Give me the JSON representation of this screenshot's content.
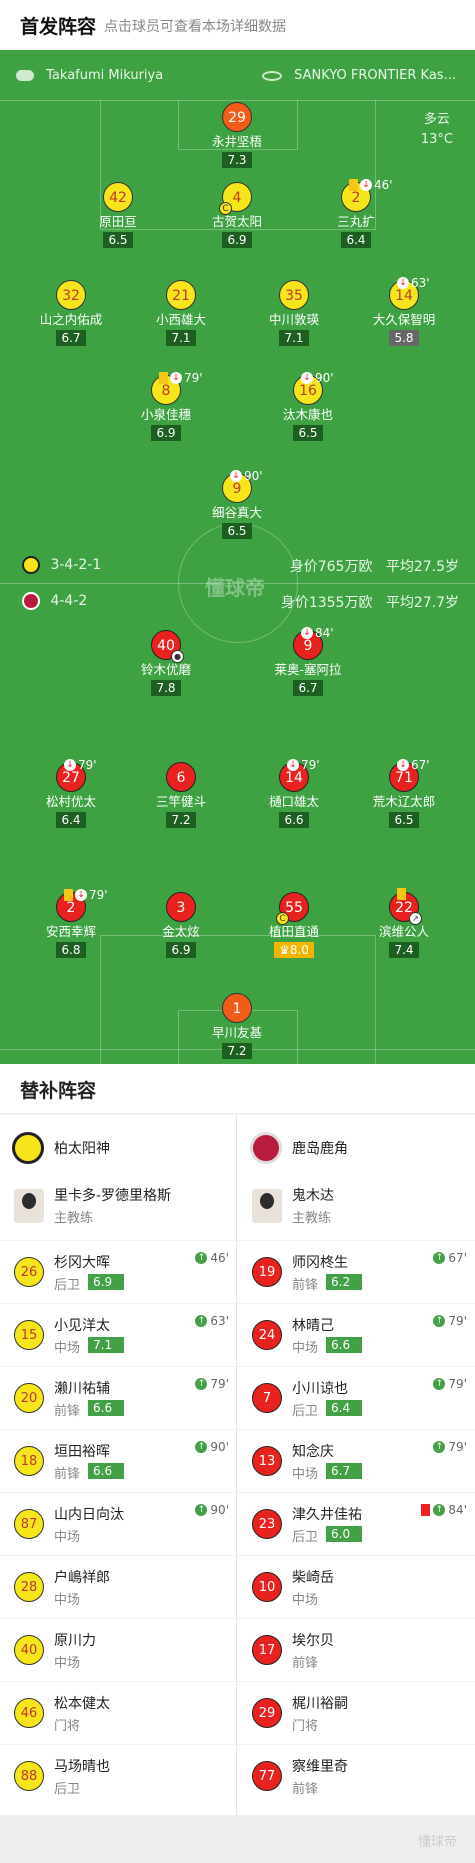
{
  "header": {
    "title": "首发阵容",
    "subtitle": "点击球员可查看本场详细数据"
  },
  "match": {
    "referee": "Takafumi Mikuriya",
    "venue": "SANKYO FRONTIER Kas...",
    "weather": "多云",
    "temperature": "13°C",
    "watermark": "懂球帝"
  },
  "home": {
    "formation": "3-4-2-1",
    "value": "身价765万欧",
    "age": "平均27.5岁"
  },
  "away": {
    "formation": "4-4-2",
    "value": "身价1355万欧",
    "age": "平均27.7岁"
  },
  "home_players": [
    {
      "num": "29",
      "name": "永井坚梧",
      "rating": "7.3",
      "style": "o"
    },
    {
      "num": "42",
      "name": "原田亘",
      "rating": "6.5",
      "style": "y"
    },
    {
      "num": "4",
      "name": "古贺太阳",
      "rating": "6.9",
      "style": "y",
      "cap": "C"
    },
    {
      "num": "2",
      "name": "三丸扩",
      "rating": "6.4",
      "style": "y",
      "minute": "46'"
    },
    {
      "num": "32",
      "name": "山之内佑成",
      "rating": "6.7",
      "style": "y"
    },
    {
      "num": "21",
      "name": "小西雄大",
      "rating": "7.1",
      "style": "y"
    },
    {
      "num": "35",
      "name": "中川敦瑛",
      "rating": "7.1",
      "style": "y"
    },
    {
      "num": "14",
      "name": "大久保智明",
      "rating": "5.8",
      "style": "y",
      "minute": "63'"
    },
    {
      "num": "8",
      "name": "小泉佳穗",
      "rating": "6.9",
      "style": "y",
      "minute": "79'"
    },
    {
      "num": "16",
      "name": "汰木康也",
      "rating": "6.5",
      "style": "y",
      "minute": "90'"
    },
    {
      "num": "9",
      "name": "细谷真大",
      "rating": "6.5",
      "style": "y",
      "minute": "90'"
    }
  ],
  "away_players": [
    {
      "num": "40",
      "name": "铃木优磨",
      "rating": "7.8",
      "style": "r"
    },
    {
      "num": "9",
      "name": "莱奥-塞阿拉",
      "rating": "6.7",
      "style": "r",
      "minute": "84'"
    },
    {
      "num": "27",
      "name": "松村优太",
      "rating": "6.4",
      "style": "r",
      "minute": "79'"
    },
    {
      "num": "6",
      "name": "三竿健斗",
      "rating": "7.2",
      "style": "r"
    },
    {
      "num": "14",
      "name": "樋口雄太",
      "rating": "6.6",
      "style": "r",
      "minute": "79'"
    },
    {
      "num": "71",
      "name": "荒木辽太郎",
      "rating": "6.5",
      "style": "r",
      "minute": "67'"
    },
    {
      "num": "2",
      "name": "安西幸辉",
      "rating": "6.8",
      "style": "r",
      "minute": "79'"
    },
    {
      "num": "3",
      "name": "金太炫",
      "rating": "6.9",
      "style": "r"
    },
    {
      "num": "55",
      "name": "植田直通",
      "rating": "8.0",
      "style": "r",
      "cap": "C"
    },
    {
      "num": "22",
      "name": "滨维公人",
      "rating": "7.4",
      "style": "r"
    },
    {
      "num": "1",
      "name": "早川友基",
      "rating": "7.2",
      "style": "o"
    }
  ],
  "bench": {
    "title": "替补阵容",
    "home_team": "柏太阳神",
    "away_team": "鹿岛鹿角",
    "home_coach": {
      "name": "里卡多-罗德里格斯",
      "role": "主教练"
    },
    "away_coach": {
      "name": "鬼木达",
      "role": "主教练"
    },
    "home": [
      {
        "num": "26",
        "name": "杉冈大晖",
        "pos": "后卫",
        "rating": "6.9",
        "minute": "46'"
      },
      {
        "num": "15",
        "name": "小见洋太",
        "pos": "中场",
        "rating": "7.1",
        "minute": "63'"
      },
      {
        "num": "20",
        "name": "濑川祐辅",
        "pos": "前锋",
        "rating": "6.6",
        "minute": "79'"
      },
      {
        "num": "18",
        "name": "垣田裕晖",
        "pos": "前锋",
        "rating": "6.6",
        "minute": "90'"
      },
      {
        "num": "87",
        "name": "山内日向汰",
        "pos": "中场",
        "rating": "",
        "minute": "90'"
      },
      {
        "num": "28",
        "name": "户嶋祥郎",
        "pos": "中场",
        "rating": "",
        "minute": ""
      },
      {
        "num": "40",
        "name": "原川力",
        "pos": "中场",
        "rating": "",
        "minute": ""
      },
      {
        "num": "46",
        "name": "松本健太",
        "pos": "门将",
        "rating": "",
        "minute": ""
      },
      {
        "num": "88",
        "name": "马场晴也",
        "pos": "后卫",
        "rating": "",
        "minute": ""
      }
    ],
    "away": [
      {
        "num": "19",
        "name": "师冈柊生",
        "pos": "前锋",
        "rating": "6.2",
        "minute": "67'"
      },
      {
        "num": "24",
        "name": "林晴己",
        "pos": "中场",
        "rating": "6.6",
        "minute": "79'"
      },
      {
        "num": "7",
        "name": "小川谅也",
        "pos": "后卫",
        "rating": "6.4",
        "minute": "79'"
      },
      {
        "num": "13",
        "name": "知念庆",
        "pos": "中场",
        "rating": "6.7",
        "minute": "79'"
      },
      {
        "num": "23",
        "name": "津久井佳祐",
        "pos": "后卫",
        "rating": "6.0",
        "minute": "84'"
      },
      {
        "num": "10",
        "name": "柴崎岳",
        "pos": "中场",
        "rating": "",
        "minute": ""
      },
      {
        "num": "17",
        "name": "埃尔贝",
        "pos": "前锋",
        "rating": "",
        "minute": ""
      },
      {
        "num": "29",
        "name": "梶川裕嗣",
        "pos": "门将",
        "rating": "",
        "minute": ""
      },
      {
        "num": "77",
        "name": "察维里奇",
        "pos": "前锋",
        "rating": "",
        "minute": ""
      }
    ]
  },
  "footer": {
    "brand": "懂球帝"
  }
}
